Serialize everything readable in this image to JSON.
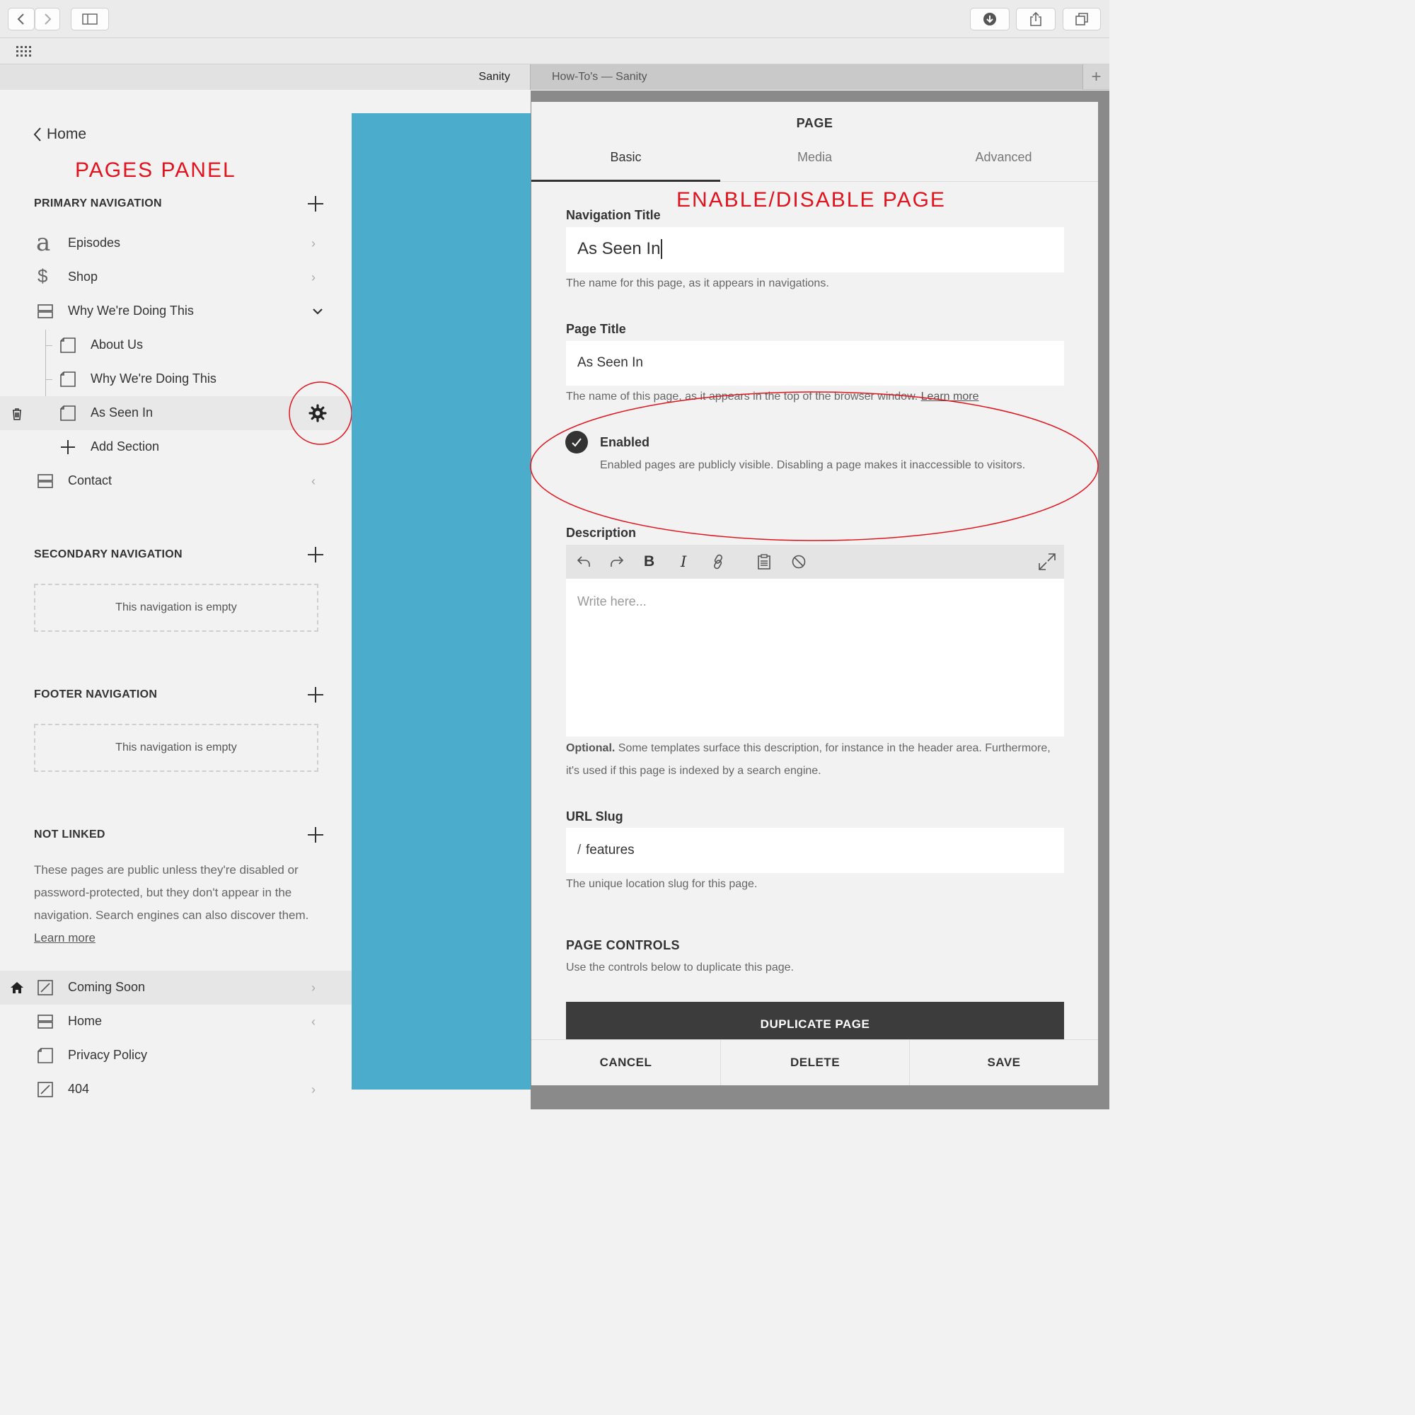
{
  "browser": {
    "tabs": [
      {
        "title": "Sanity"
      },
      {
        "title": "How-To's — Sanity"
      }
    ],
    "new_tab": "+"
  },
  "panel": {
    "back_label": "Home",
    "annotation": "PAGES PANEL",
    "primary": {
      "heading": "PRIMARY NAVIGATION",
      "items": [
        {
          "label": "Episodes",
          "icon": "link-a-icon"
        },
        {
          "label": "Shop",
          "icon": "dollar-icon"
        },
        {
          "label": "Why We're Doing This",
          "icon": "folder-icon"
        },
        {
          "label": "About Us",
          "icon": "page-icon"
        },
        {
          "label": "Why We're Doing This",
          "icon": "page-icon"
        },
        {
          "label": "As Seen In",
          "icon": "page-icon"
        },
        {
          "label": "Add Section",
          "icon": "plus-icon"
        },
        {
          "label": "Contact",
          "icon": "folder-icon"
        }
      ]
    },
    "secondary": {
      "heading": "SECONDARY NAVIGATION",
      "empty": "This navigation is empty"
    },
    "footer": {
      "heading": "FOOTER NAVIGATION",
      "empty": "This navigation is empty"
    },
    "not_linked": {
      "heading": "NOT LINKED",
      "text": "These pages are public unless they're disabled or password-protected, but they don't appear in the navigation. Search engines can also discover them.",
      "learn_more": "Learn more",
      "items": [
        {
          "label": "Coming Soon",
          "icon": "cover-page-icon"
        },
        {
          "label": "Home",
          "icon": "folder-icon"
        },
        {
          "label": "Privacy Policy",
          "icon": "page-icon"
        },
        {
          "label": "404",
          "icon": "cover-page-icon"
        }
      ]
    }
  },
  "dialog": {
    "title": "PAGE",
    "tabs": [
      "Basic",
      "Media",
      "Advanced"
    ],
    "active_tab": "Basic",
    "annotation": "ENABLE/DISABLE PAGE",
    "nav_title": {
      "label": "Navigation Title",
      "value": "As Seen In",
      "help": "The name for this page, as it appears in navigations."
    },
    "page_title": {
      "label": "Page Title",
      "value": "As Seen In",
      "help": "The name of this page, as it appears in the top of the browser window.",
      "learn_more": "Learn more"
    },
    "enabled": {
      "label": "Enabled",
      "checked": true,
      "help": "Enabled pages are publicly visible. Disabling a page makes it inaccessible to visitors."
    },
    "description": {
      "label": "Description",
      "placeholder": "Write here...",
      "help_bold": "Optional.",
      "help": "Some templates surface this description, for instance in the header area. Furthermore, it's used if this page is indexed by a search engine."
    },
    "url_slug": {
      "label": "URL Slug",
      "value": "features",
      "prefix": "/",
      "help": "The unique location slug for this page."
    },
    "controls": {
      "heading": "PAGE CONTROLS",
      "help": "Use the controls below to duplicate this page.",
      "duplicate": "DUPLICATE PAGE"
    },
    "footer": {
      "cancel": "CANCEL",
      "delete": "DELETE",
      "save": "SAVE"
    }
  },
  "colors": {
    "accent_red": "#e0141e",
    "canvas_blue": "#4baccc",
    "dark_button": "#3c3c3c"
  }
}
